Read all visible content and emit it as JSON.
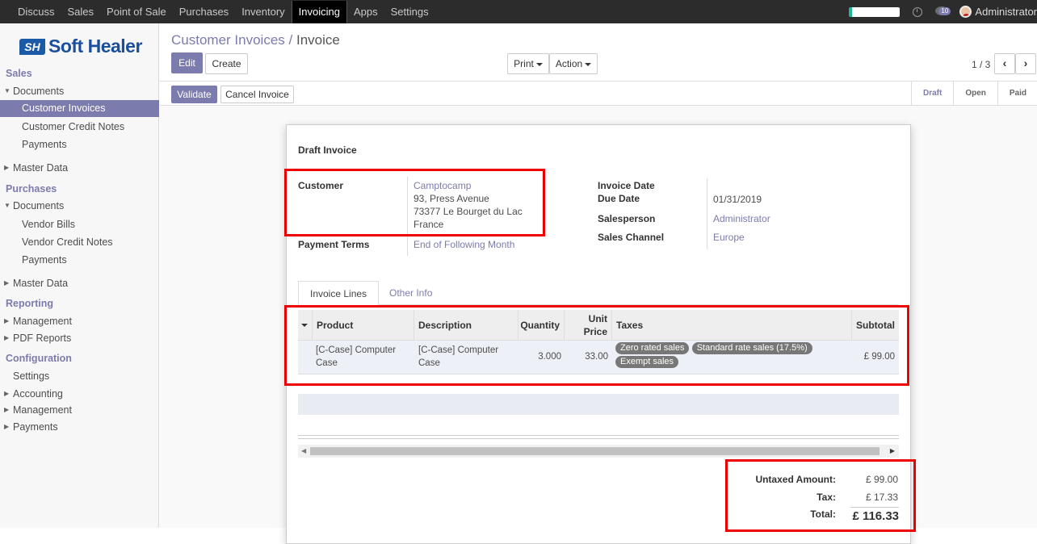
{
  "topbar": {
    "menus": [
      "Discuss",
      "Sales",
      "Point of Sale",
      "Purchases",
      "Inventory",
      "Invoicing",
      "Apps",
      "Settings"
    ],
    "active_menu": "Invoicing",
    "message_count": "10",
    "user": "Administrator"
  },
  "logo": {
    "mark": "SH",
    "text": "Soft Healer"
  },
  "sidebar": {
    "sales_header": "Sales",
    "documents": "Documents",
    "customer_invoices": "Customer Invoices",
    "customer_credit_notes": "Customer Credit Notes",
    "payments": "Payments",
    "master_data": "Master Data",
    "purchases_header": "Purchases",
    "p_documents": "Documents",
    "vendor_bills": "Vendor Bills",
    "vendor_credit_notes": "Vendor Credit Notes",
    "p_payments": "Payments",
    "p_master_data": "Master Data",
    "reporting_header": "Reporting",
    "management": "Management",
    "pdf_reports": "PDF Reports",
    "configuration_header": "Configuration",
    "settings": "Settings",
    "accounting": "Accounting",
    "c_management": "Management",
    "c_payments": "Payments"
  },
  "breadcrumb": {
    "parent": "Customer Invoices",
    "sep": "/",
    "current": "Invoice"
  },
  "buttons": {
    "edit": "Edit",
    "create": "Create",
    "print": "Print",
    "action": "Action",
    "validate": "Validate",
    "cancel_invoice": "Cancel Invoice"
  },
  "pager": {
    "value": "1 / 3"
  },
  "stages": [
    "Draft",
    "Open",
    "Paid"
  ],
  "invoice": {
    "title": "Draft Invoice",
    "customer_label": "Customer",
    "customer_name": "Camptocamp",
    "customer_addr1": "93, Press Avenue",
    "customer_addr2": "73377 Le Bourget du Lac",
    "customer_addr3": "France",
    "payment_terms_label": "Payment Terms",
    "payment_terms": "End of Following Month",
    "invoice_date_label": "Invoice Date",
    "due_date_label": "Due Date",
    "due_date": "01/31/2019",
    "salesperson_label": "Salesperson",
    "salesperson": "Administrator",
    "sales_channel_label": "Sales Channel",
    "sales_channel": "Europe"
  },
  "tabs": {
    "invoice_lines": "Invoice Lines",
    "other_info": "Other Info"
  },
  "lines": {
    "headers": {
      "product": "Product",
      "description": "Description",
      "quantity": "Quantity",
      "unit_price_1": "Unit",
      "unit_price_2": "Price",
      "taxes": "Taxes",
      "subtotal": "Subtotal"
    },
    "row": {
      "product_1": "[C-Case] Computer",
      "product_2": "Case",
      "description_1": "[C-Case] Computer",
      "description_2": "Case",
      "quantity": "3.000",
      "unit_price": "33.00",
      "tax1": "Zero rated sales",
      "tax2": "Standard rate sales (17.5%)",
      "tax3": "Exempt sales",
      "subtotal": "£ 99.00"
    }
  },
  "totals": {
    "untaxed_label": "Untaxed Amount:",
    "untaxed": "£ 99.00",
    "tax_label": "Tax:",
    "tax": "£ 17.33",
    "total_label": "Total:",
    "total": "£ 116.33"
  }
}
